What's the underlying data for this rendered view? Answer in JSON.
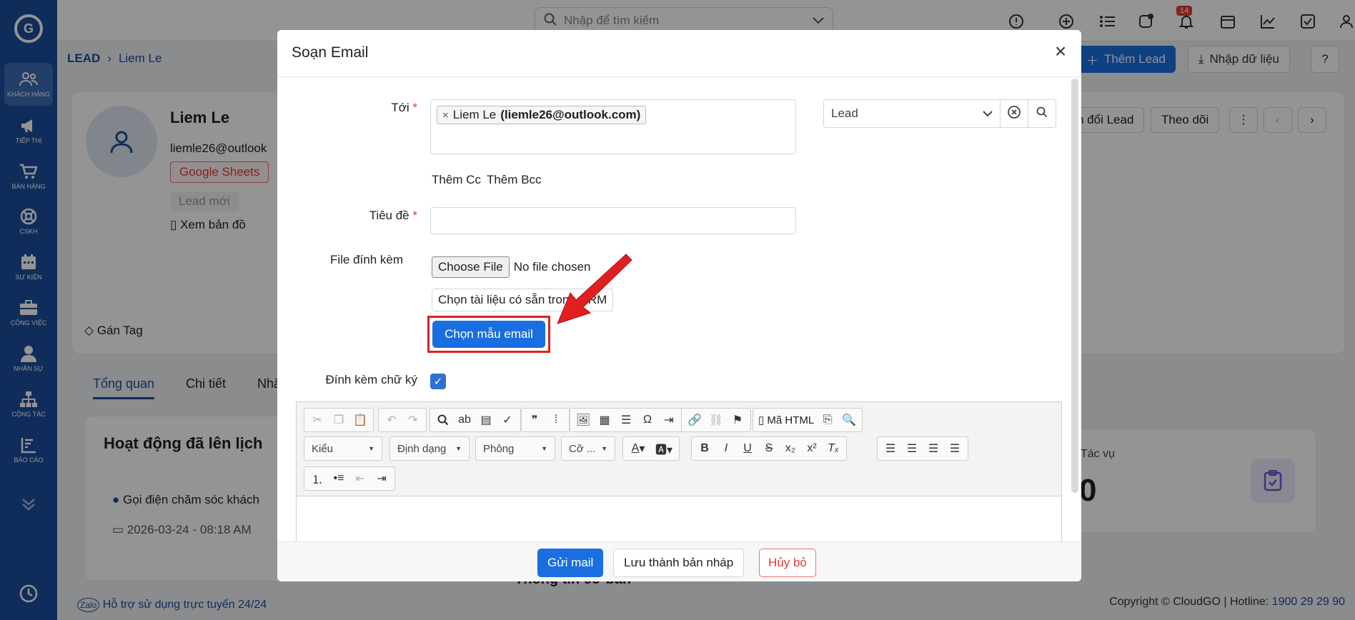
{
  "sidebar": {
    "items": [
      {
        "label": "Khách hàng",
        "icon": "users-icon"
      },
      {
        "label": "Tiếp thị",
        "icon": "megaphone-icon"
      },
      {
        "label": "Bán hàng",
        "icon": "cart-icon"
      },
      {
        "label": "CSKH",
        "icon": "lifebuoy-icon"
      },
      {
        "label": "Sự kiện",
        "icon": "calendar-icon"
      },
      {
        "label": "Công việc",
        "icon": "briefcase-icon"
      },
      {
        "label": "Nhân sự",
        "icon": "person-icon"
      },
      {
        "label": "Cộng tác",
        "icon": "org-chart-icon"
      },
      {
        "label": "Báo cáo",
        "icon": "report-icon"
      }
    ]
  },
  "topbar": {
    "search_placeholder": "Nhập để tìm kiếm",
    "notification_count": "14"
  },
  "breadcrumb": {
    "root": "LEAD",
    "current": "Liem Le"
  },
  "header_buttons": {
    "add_lead": "Thêm Lead",
    "import": "Nhập dữ liệu"
  },
  "profile": {
    "name": "Liem Le",
    "email_partial": "liemle26@outlook",
    "source_tag": "Google Sheets",
    "status_tag": "Lead mới",
    "map_link": "Xem bản đồ",
    "assign_tag": "Gán Tag"
  },
  "right_buttons": {
    "convert": "n đổi Lead",
    "follow": "Theo dõi"
  },
  "tabs": [
    "Tổng quan",
    "Chi tiết",
    "Nhă"
  ],
  "activity": {
    "title": "Hoạt động đã lên lịch",
    "item": "Gọi điện chăm sóc khách",
    "date": "2026-03-24 - 08:18 AM"
  },
  "tasks_card": {
    "title": "Tác vụ",
    "count": "0",
    "partial_heading": "Thông tin cơ bản"
  },
  "footer": {
    "support": "Hỗ trợ sử dụng trực tuyến 24/24",
    "copyright": "Copyright © CloudGO | Hotline: ",
    "hotline": "1900 29 29 90"
  },
  "modal": {
    "title": "Soạn Email",
    "to_label": "Tới",
    "recipient_name": "Liem Le",
    "recipient_email": "(liemle26@outlook.com)",
    "module_select": "Lead",
    "add_cc": "Thêm Cc",
    "add_bcc": "Thêm Bcc",
    "subject_label": "Tiêu đề",
    "subject_value": "",
    "attachment_label": "File đính kèm",
    "choose_file": "Choose File",
    "no_file": "No file chosen",
    "crm_docs": "Chọn tài liệu có sẵn trong CRM",
    "choose_template": "Chọn mẫu email",
    "signature_label": "Đính kèm chữ ký",
    "signature_checked": true,
    "editor": {
      "style_combo": "Kiểu",
      "format_combo": "Định dạng",
      "font_combo": "Phông",
      "size_combo": "Cỡ ...",
      "html_source": "Mã HTML"
    },
    "send": "Gửi mail",
    "save_draft": "Lưu thành bản nháp",
    "cancel": "Hủy bỏ"
  },
  "colors": {
    "sidebar": "#1d4d9c",
    "primary": "#1a6fe0",
    "danger": "#e53935",
    "highlight": "#e02020"
  }
}
